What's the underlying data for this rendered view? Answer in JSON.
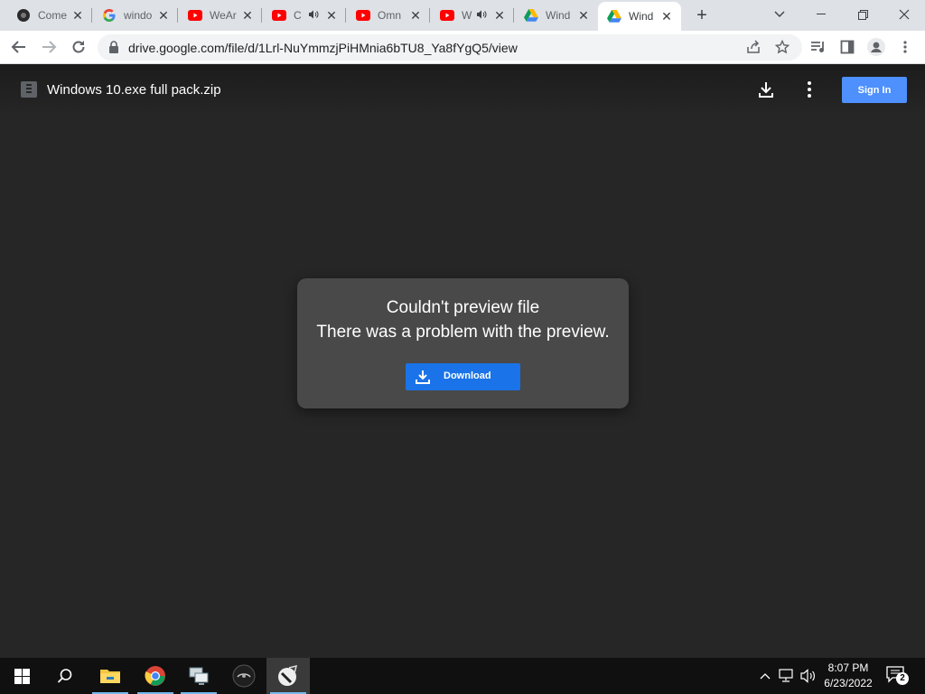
{
  "browser": {
    "tabs": [
      {
        "title": "Come",
        "favicon": "dark-circle-icon",
        "audio": false,
        "active": false
      },
      {
        "title": "windo",
        "favicon": "google-icon",
        "audio": false,
        "active": false
      },
      {
        "title": "WeAr",
        "favicon": "youtube-icon",
        "audio": false,
        "active": false
      },
      {
        "title": "C",
        "favicon": "youtube-icon",
        "audio": true,
        "active": false
      },
      {
        "title": "Omn",
        "favicon": "youtube-icon",
        "audio": false,
        "active": false
      },
      {
        "title": "W",
        "favicon": "youtube-icon",
        "audio": true,
        "active": false
      },
      {
        "title": "Wind",
        "favicon": "google-drive-icon",
        "audio": false,
        "active": false
      },
      {
        "title": "Wind",
        "favicon": "google-drive-icon",
        "audio": false,
        "active": true
      }
    ],
    "url": "drive.google.com/file/d/1Lrl-NuYmmzjPiHMnia6bTU8_Ya8fYgQ5/view"
  },
  "viewer": {
    "file_name": "Windows 10.exe full pack.zip",
    "sign_in_label": "Sign In",
    "error_title": "Couldn't preview file",
    "error_message": "There was a problem with the preview.",
    "download_label": "Download"
  },
  "taskbar": {
    "time": "8:07 PM",
    "date": "6/23/2022",
    "notification_count": "2"
  },
  "colors": {
    "accent": "#1a73e8",
    "sign_in": "#4d90fe",
    "viewer_bg": "#262626",
    "card_bg": "#494949"
  }
}
